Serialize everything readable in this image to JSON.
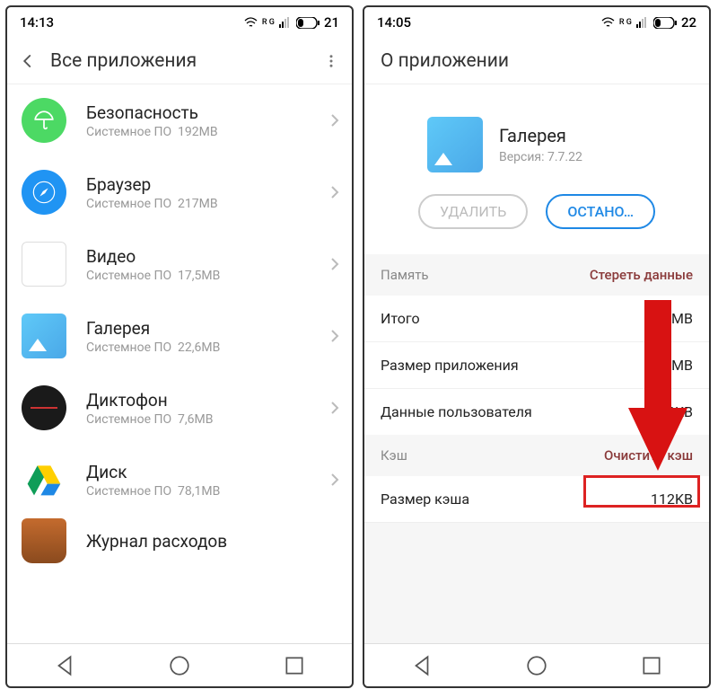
{
  "left": {
    "statusbar": {
      "time": "14:13",
      "battery": "21",
      "net": "R  G"
    },
    "header": {
      "title": "Все приложения"
    },
    "apps": [
      {
        "name": "Безопасность",
        "sub": "Системное ПО",
        "size": "192MB",
        "icon": "security"
      },
      {
        "name": "Браузер",
        "sub": "Системное ПО",
        "size": "217MB",
        "icon": "browser"
      },
      {
        "name": "Видео",
        "sub": "Системное ПО",
        "size": "17,5MB",
        "icon": "video"
      },
      {
        "name": "Галерея",
        "sub": "Системное ПО",
        "size": "22,6MB",
        "icon": "gallery"
      },
      {
        "name": "Диктофон",
        "sub": "Системное ПО",
        "size": "7,6MB",
        "icon": "recorder"
      },
      {
        "name": "Диск",
        "sub": "Системное ПО",
        "size": "78,1MB",
        "icon": "drive"
      },
      {
        "name": "Журнал расходов",
        "sub": "",
        "size": "",
        "icon": "journal"
      }
    ]
  },
  "right": {
    "statusbar": {
      "time": "14:05",
      "battery": "22",
      "net": "R  G"
    },
    "header": {
      "title": "О приложении"
    },
    "app": {
      "name": "Галерея",
      "version_label": "Версия: 7.7.22"
    },
    "buttons": {
      "delete": "УДАЛИТЬ",
      "stop": "ОСТАНО…"
    },
    "memory": {
      "section": "Память",
      "action": "Стереть данные",
      "rows": [
        {
          "k": "Итого",
          "v": "6MB"
        },
        {
          "k": "Размер приложения",
          "v": "MB"
        },
        {
          "k": "Данные пользователя",
          "v": "96KB"
        }
      ]
    },
    "cache": {
      "section": "Кэш",
      "action": "Очистить кэш",
      "rows": [
        {
          "k": "Размер кэша",
          "v": "112KB"
        }
      ]
    }
  }
}
